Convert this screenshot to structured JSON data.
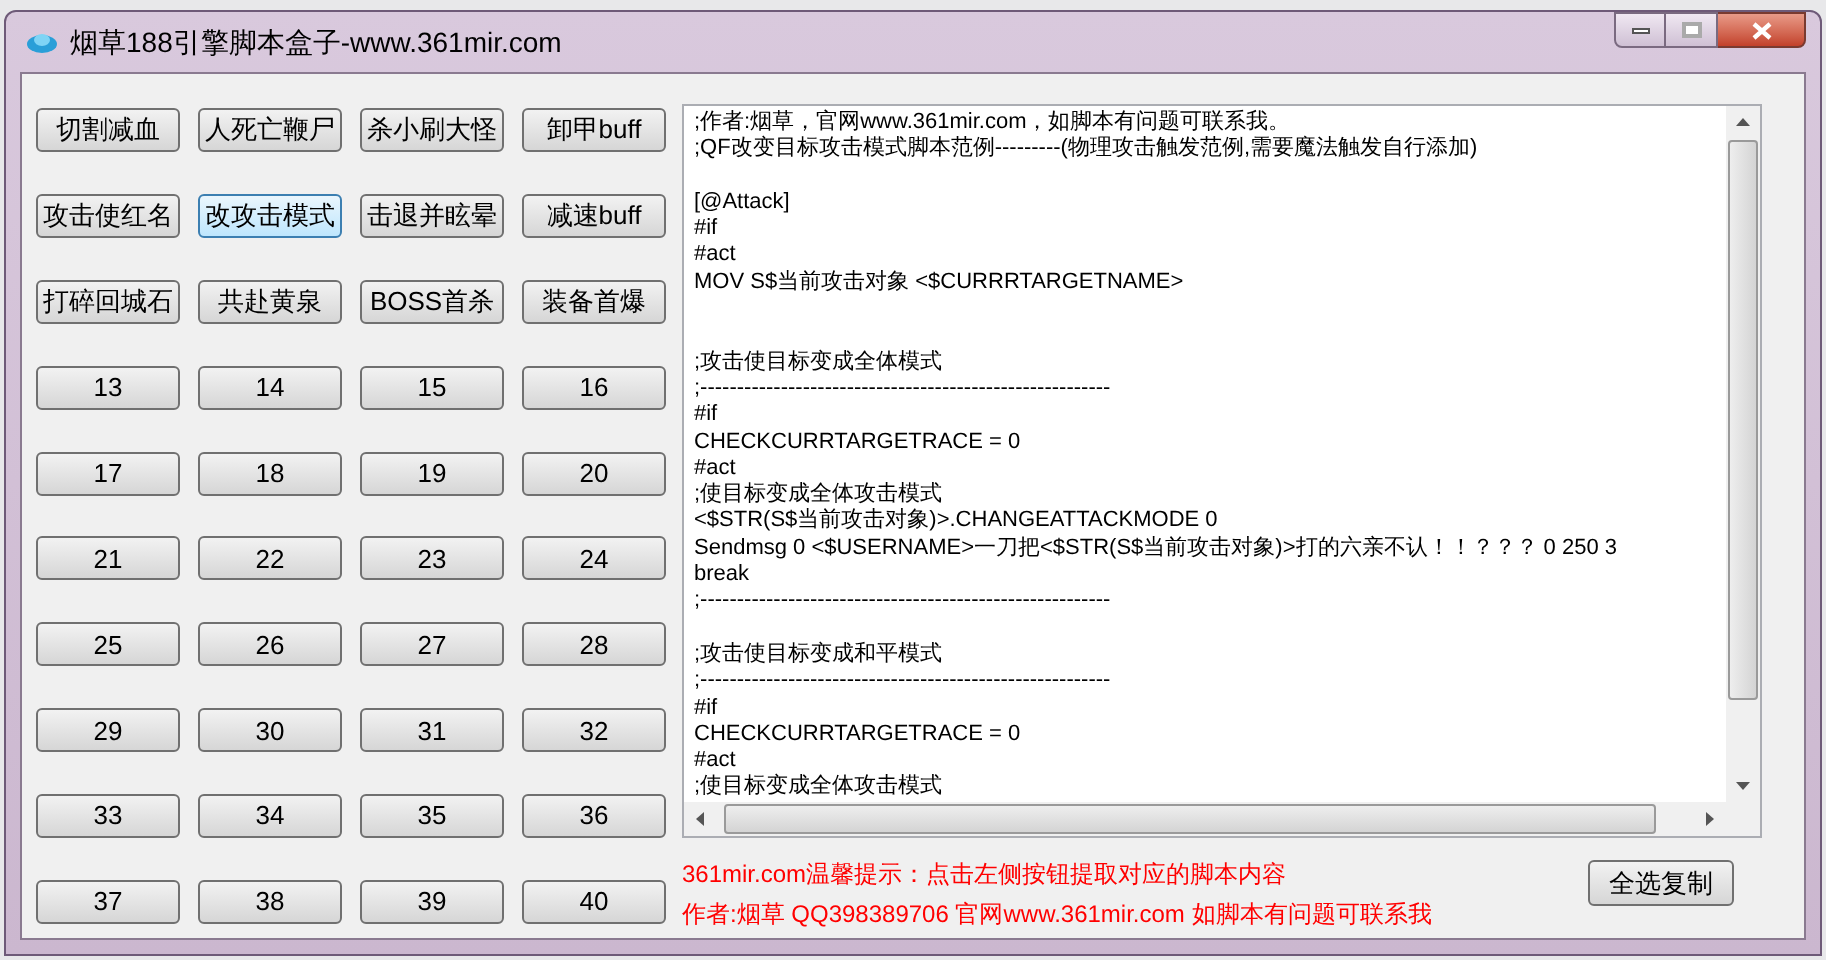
{
  "window": {
    "title": "烟草188引擎脚本盒子-www.361mir.com"
  },
  "buttons": [
    {
      "label": "切割减血",
      "selected": false
    },
    {
      "label": "人死亡鞭尸",
      "selected": false
    },
    {
      "label": "杀小刷大怪",
      "selected": false
    },
    {
      "label": "卸甲buff",
      "selected": false
    },
    {
      "label": "攻击使红名",
      "selected": false
    },
    {
      "label": "改攻击模式",
      "selected": true
    },
    {
      "label": "击退并眩晕",
      "selected": false
    },
    {
      "label": "减速buff",
      "selected": false
    },
    {
      "label": "打碎回城石",
      "selected": false
    },
    {
      "label": "共赴黄泉",
      "selected": false
    },
    {
      "label": "BOSS首杀",
      "selected": false
    },
    {
      "label": "装备首爆",
      "selected": false
    },
    {
      "label": "13",
      "selected": false
    },
    {
      "label": "14",
      "selected": false
    },
    {
      "label": "15",
      "selected": false
    },
    {
      "label": "16",
      "selected": false
    },
    {
      "label": "17",
      "selected": false
    },
    {
      "label": "18",
      "selected": false
    },
    {
      "label": "19",
      "selected": false
    },
    {
      "label": "20",
      "selected": false
    },
    {
      "label": "21",
      "selected": false
    },
    {
      "label": "22",
      "selected": false
    },
    {
      "label": "23",
      "selected": false
    },
    {
      "label": "24",
      "selected": false
    },
    {
      "label": "25",
      "selected": false
    },
    {
      "label": "26",
      "selected": false
    },
    {
      "label": "27",
      "selected": false
    },
    {
      "label": "28",
      "selected": false
    },
    {
      "label": "29",
      "selected": false
    },
    {
      "label": "30",
      "selected": false
    },
    {
      "label": "31",
      "selected": false
    },
    {
      "label": "32",
      "selected": false
    },
    {
      "label": "33",
      "selected": false
    },
    {
      "label": "34",
      "selected": false
    },
    {
      "label": "35",
      "selected": false
    },
    {
      "label": "36",
      "selected": false
    },
    {
      "label": "37",
      "selected": false
    },
    {
      "label": "38",
      "selected": false
    },
    {
      "label": "39",
      "selected": false
    },
    {
      "label": "40",
      "selected": false
    }
  ],
  "script": {
    "blocks": [
      {
        "wide_gap": false,
        "lines": [
          ";作者:烟草，官网www.361mir.com，如脚本有问题可联系我。",
          ";QF改变目标攻击模式脚本范例---------(物理攻击触发范例,需要魔法触发自行添加)"
        ]
      },
      {
        "wide_gap": false,
        "lines": [
          "[@Attack]",
          "#if",
          "#act",
          "MOV S$当前攻击对象 <$CURRRTARGETNAME>"
        ]
      },
      {
        "wide_gap": true,
        "lines": [
          ";攻击使目标变成全体模式",
          ";--------------------------------------------------------",
          "#if",
          "CHECKCURRTARGETRACE = 0",
          "#act",
          ";使目标变成全体攻击模式",
          "<$STR(S$当前攻击对象)>.CHANGEATTACKMODE 0",
          "Sendmsg 0 <$USERNAME>一刀把<$STR(S$当前攻击对象)>打的六亲不认！！？？？ 0 250 3",
          "break",
          ";--------------------------------------------------------"
        ]
      },
      {
        "wide_gap": false,
        "lines": [
          ";攻击使目标变成和平模式",
          ";--------------------------------------------------------",
          "#if",
          "CHECKCURRTARGETRACE = 0",
          "#act",
          ";使目标变成全体攻击模式"
        ]
      }
    ]
  },
  "hints": [
    "361mir.com温馨提示：点击左侧按钮提取对应的脚本内容",
    "作者:烟草 QQ398389706 官网www.361mir.com 如脚本有问题可联系我"
  ],
  "copy_button": "全选复制"
}
